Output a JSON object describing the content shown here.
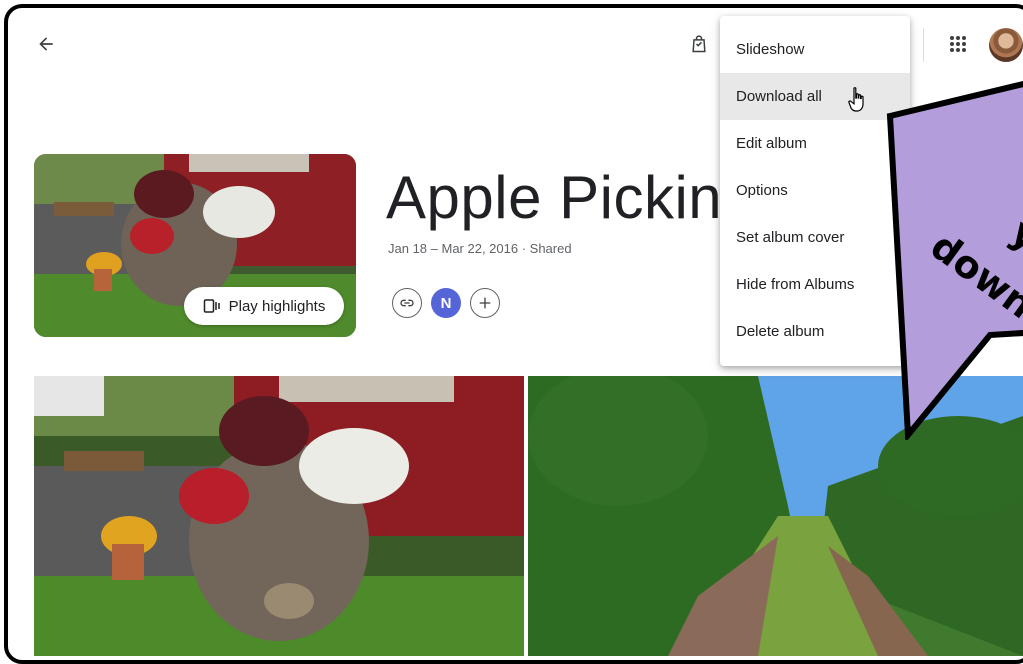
{
  "header": {
    "back_icon": "arrow-back-icon",
    "bag_icon": "shopping-bag-icon",
    "apps_icon": "apps-grid-icon",
    "avatar_icon": "user-avatar"
  },
  "album": {
    "title": "Apple Picking",
    "meta": "Jan 18 – Mar 22, 2016 · Shared",
    "play_highlights_label": "Play highlights",
    "share_avatar_initial": "N"
  },
  "menu": {
    "items": [
      {
        "label": "Slideshow"
      },
      {
        "label": "Download all"
      },
      {
        "label": "Edit album"
      },
      {
        "label": "Options"
      },
      {
        "label": "Set album cover"
      },
      {
        "label": "Hide from Albums"
      },
      {
        "label": "Delete album"
      }
    ],
    "hovered_item": "Download all"
  },
  "callout": {
    "text_line1": "y",
    "text_line2": "downl",
    "fill_color": "#b39ddb"
  },
  "colors": {
    "accent_avatar": "#5565d8",
    "menu_hover": "#e8e8e8",
    "text_primary": "#202124",
    "text_secondary": "#5f6368"
  }
}
